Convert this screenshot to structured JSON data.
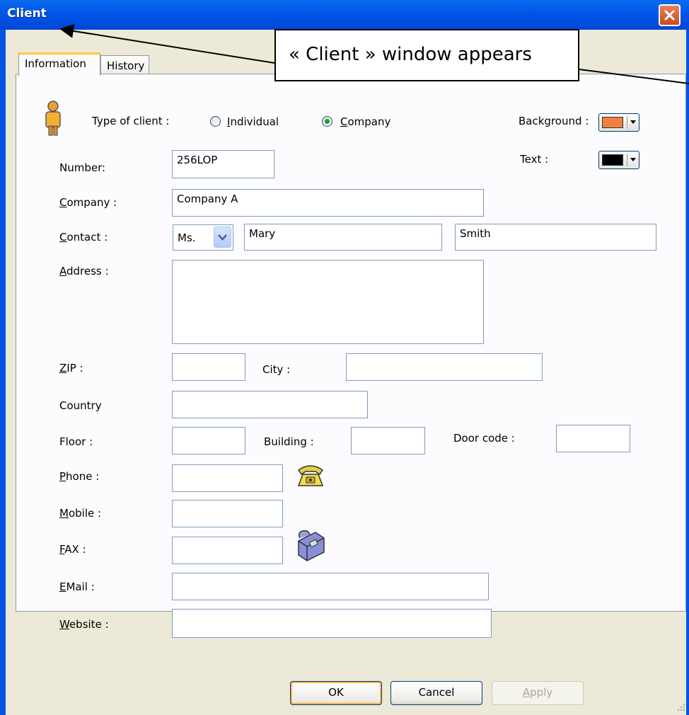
{
  "window": {
    "title": "Client",
    "colors": {
      "titlebar": "#0054e3",
      "close": "#c74b1f",
      "background": "#ece9d8"
    }
  },
  "tabs": [
    {
      "label": "Information",
      "active": true
    },
    {
      "label": "History",
      "active": false
    }
  ],
  "annotation": {
    "text": "« Client » window appears"
  },
  "client_type": {
    "label": "Type of client :",
    "options": [
      {
        "label": "Individual",
        "selected": false
      },
      {
        "label": "Company",
        "selected": true
      }
    ]
  },
  "colors": {
    "background_label": "Background :",
    "background_value": "#f08040",
    "text_label": "Text :",
    "text_value": "#000000"
  },
  "form": {
    "number_label": "Number:",
    "number_value": "256LOP",
    "company_label": "Company :",
    "company_value": "Company A",
    "contact_label": "Contact :",
    "title_value": "Ms.",
    "first_name": "Mary",
    "last_name": "Smith",
    "address_label": "Address :",
    "address_value": "",
    "zip_label": "ZIP :",
    "zip_value": "",
    "city_label": "City :",
    "city_value": "",
    "country_label": "Country",
    "country_value": "",
    "floor_label": "Floor :",
    "floor_value": "",
    "building_label": "Building :",
    "building_value": "",
    "doorcode_label": "Door code :",
    "doorcode_value": "",
    "phone_label": "Phone :",
    "phone_value": "",
    "mobile_label": "Mobile :",
    "mobile_value": "",
    "fax_label": "FAX :",
    "fax_value": "",
    "email_label": "EMail :",
    "email_value": "",
    "website_label": "Website :",
    "website_value": ""
  },
  "buttons": {
    "ok": "OK",
    "cancel": "Cancel",
    "apply": "Apply"
  },
  "icons": {
    "person": "person-icon",
    "phone": "telephone-icon",
    "fax": "fax-machine-icon",
    "close": "close-icon"
  }
}
